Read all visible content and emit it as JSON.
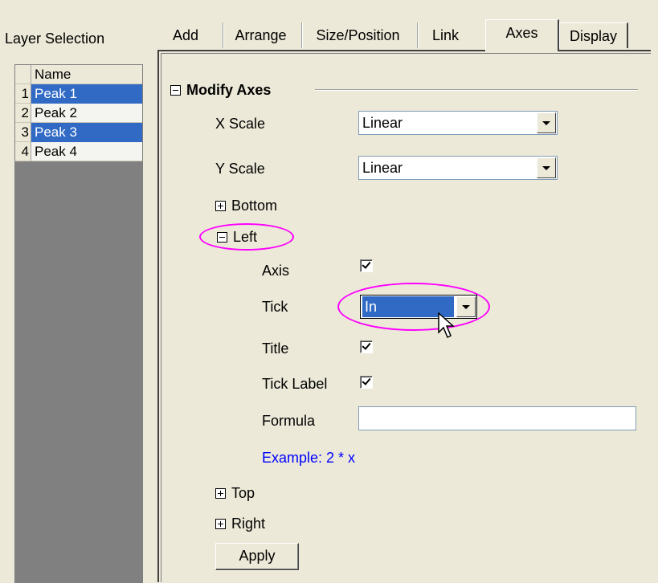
{
  "layer_panel": {
    "title": "Layer Selection",
    "header": "Name",
    "rows": [
      {
        "num": "1",
        "name": "Peak 1",
        "selected": true
      },
      {
        "num": "2",
        "name": "Peak 2",
        "selected": false
      },
      {
        "num": "3",
        "name": "Peak 3",
        "selected": true
      },
      {
        "num": "4",
        "name": "Peak 4",
        "selected": false
      }
    ]
  },
  "tabs": [
    "Add",
    "Arrange",
    "Size/Position",
    "Link",
    "Axes",
    "Display"
  ],
  "active_tab": "Axes",
  "modify_axes": {
    "title": "Modify Axes",
    "x_scale": {
      "label": "X Scale",
      "value": "Linear"
    },
    "y_scale": {
      "label": "Y Scale",
      "value": "Linear"
    },
    "bottom": "Bottom",
    "left": {
      "label": "Left",
      "axis": {
        "label": "Axis",
        "checked": true
      },
      "tick": {
        "label": "Tick",
        "value": "In"
      },
      "title": {
        "label": "Title",
        "checked": true
      },
      "tick_label": {
        "label": "Tick Label",
        "checked": true
      },
      "formula": {
        "label": "Formula",
        "value": ""
      },
      "example": "Example: 2 * x"
    },
    "top": "Top",
    "right": "Right",
    "apply": "Apply"
  },
  "colors": {
    "selection": "#316ac5",
    "highlight": "#ff00ff",
    "example_text": "#0000ff"
  }
}
